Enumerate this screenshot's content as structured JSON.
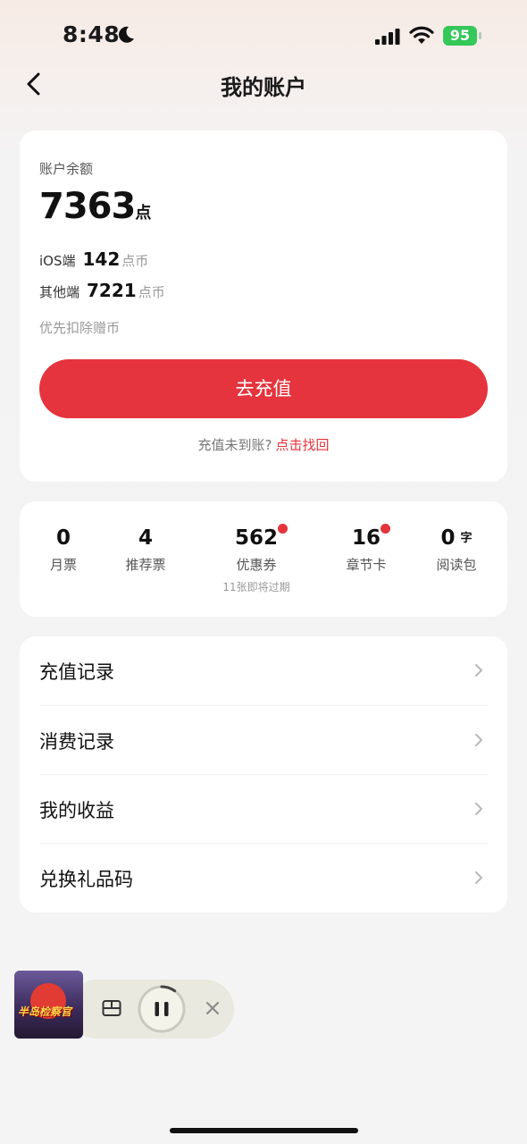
{
  "status_bar": {
    "time": "8:48",
    "battery": "95"
  },
  "nav": {
    "title": "我的账户"
  },
  "balance": {
    "label": "账户余额",
    "value": "7363",
    "unit": "点",
    "ios_label": "iOS端",
    "ios_value": "142",
    "ios_unit": "点币",
    "other_label": "其他端",
    "other_value": "7221",
    "other_unit": "点币",
    "priority_note": "优先扣除赠币",
    "recharge_button": "去充值",
    "missing_text": "充值未到账?",
    "missing_link": "点击找回"
  },
  "stats": [
    {
      "value": "0",
      "label": "月票"
    },
    {
      "value": "4",
      "label": "推荐票"
    },
    {
      "value": "562",
      "label": "优惠券",
      "note": "11张即将过期"
    },
    {
      "value": "16",
      "label": "章节卡"
    },
    {
      "value": "0",
      "suffix": "字",
      "label": "阅读包"
    }
  ],
  "menu": [
    {
      "label": "充值记录"
    },
    {
      "label": "消费记录"
    },
    {
      "label": "我的收益"
    },
    {
      "label": "兑换礼品码"
    }
  ],
  "player": {
    "cover_title": "半岛检察官",
    "progress": 0.1
  },
  "colors": {
    "accent": "#e5343d",
    "battery_green": "#34c759"
  }
}
